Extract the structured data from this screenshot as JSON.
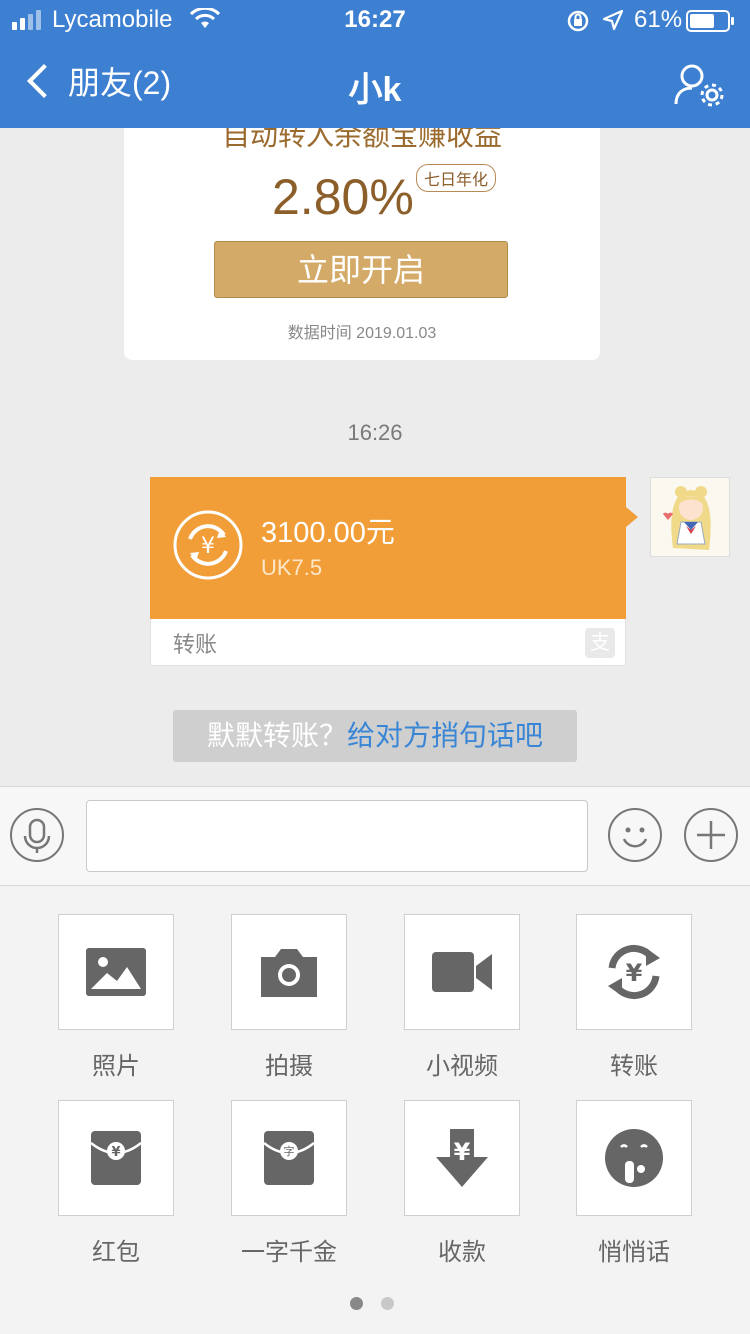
{
  "status": {
    "carrier": "Lycamobile",
    "time": "16:27",
    "battery": "61%"
  },
  "nav": {
    "back_label": "朋友(2)",
    "title": "小k"
  },
  "promo": {
    "text": "自动转入余额宝赚收益",
    "rate": "2.80%",
    "rate_tag": "七日年化",
    "button": "立即开启",
    "date": "数据时间 2019.01.03"
  },
  "chat": {
    "time": "16:26",
    "transfer": {
      "amount": "3100.00元",
      "memo": "UK7.5",
      "label": "转账",
      "alipay_mark": "支"
    }
  },
  "hint": {
    "prefix": "默默转账？",
    "link": "给对方捎句话吧"
  },
  "input": {
    "value": "",
    "placeholder": ""
  },
  "actions": [
    {
      "label": "照片",
      "icon": "photo-icon"
    },
    {
      "label": "拍摄",
      "icon": "camera-icon"
    },
    {
      "label": "小视频",
      "icon": "video-icon"
    },
    {
      "label": "转账",
      "icon": "transfer-icon"
    },
    {
      "label": "红包",
      "icon": "red-envelope-icon"
    },
    {
      "label": "一字千金",
      "icon": "word-envelope-icon"
    },
    {
      "label": "收款",
      "icon": "receive-money-icon"
    },
    {
      "label": "悄悄话",
      "icon": "whisper-icon"
    }
  ],
  "pager": {
    "total": 2,
    "current": 1
  },
  "colors": {
    "nav_bg": "#3d7fd1",
    "transfer_orange": "#f19e38",
    "promo_gold": "#d4aa68",
    "link_blue": "#3a86d6",
    "icon_gray": "#666666"
  }
}
